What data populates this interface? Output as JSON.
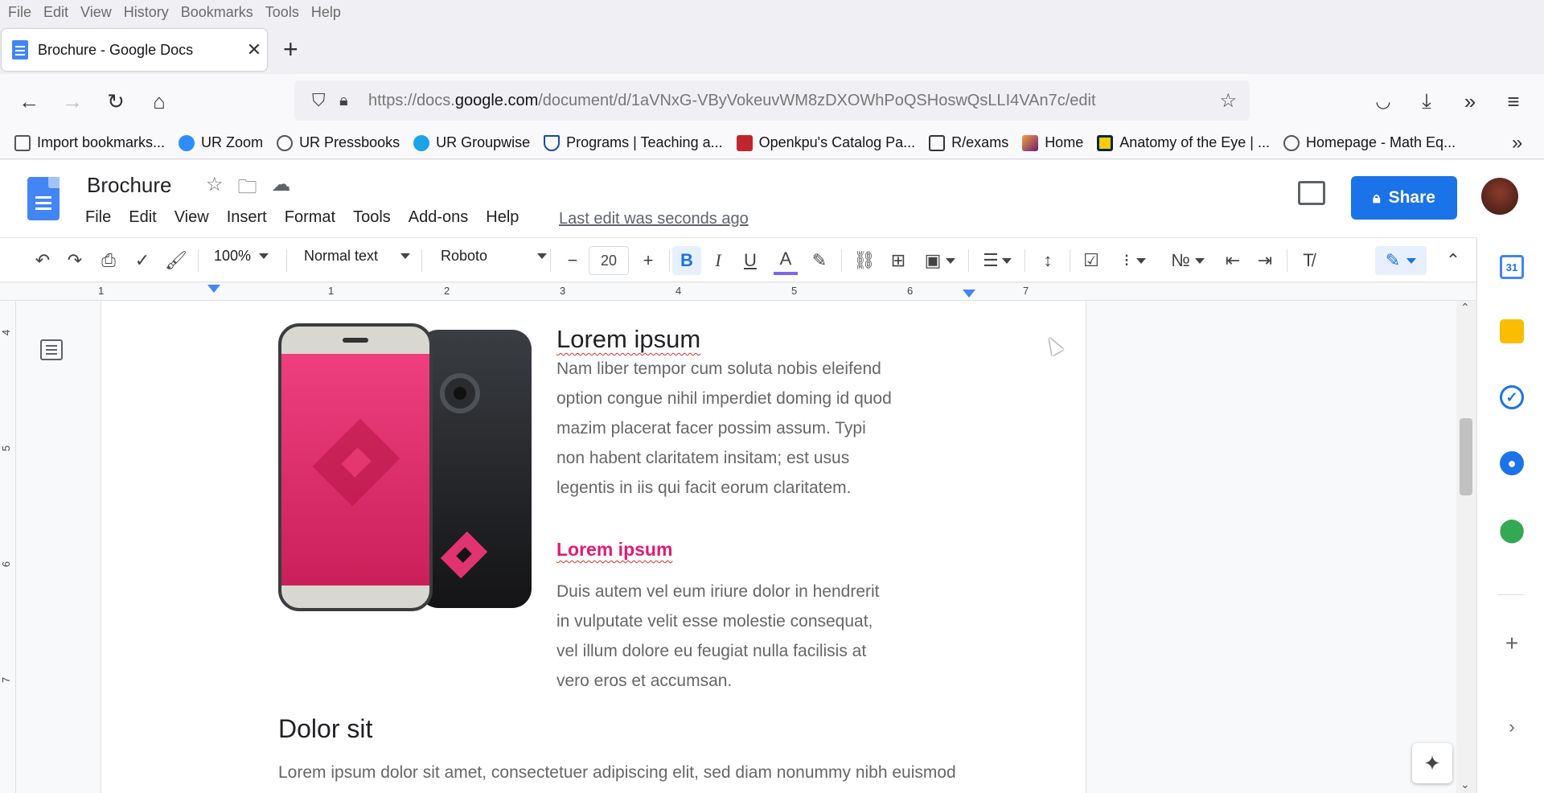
{
  "browser": {
    "menu": [
      "File",
      "Edit",
      "View",
      "History",
      "Bookmarks",
      "Tools",
      "Help"
    ],
    "tab_title": "Brochure - Google Docs",
    "url_prefix": "https://docs.",
    "url_domain": "google.com",
    "url_path": "/document/d/1aVNxG-VByVokeuvWM8zDXOWhPoQSHoswQsLLI4VAn7c/edit",
    "bookmarks": [
      {
        "label": "Import bookmarks...",
        "icon": "import-icon",
        "color": "#555555"
      },
      {
        "label": "UR Zoom",
        "icon": "zoom-icon",
        "color": "#2d8cff"
      },
      {
        "label": "UR Pressbooks",
        "icon": "globe-icon",
        "color": "#555555"
      },
      {
        "label": "UR Groupwise",
        "icon": "groupwise-icon",
        "color": "#1aa3e8"
      },
      {
        "label": "Programs | Teaching a...",
        "icon": "programs-icon",
        "color": "#1a4b9c"
      },
      {
        "label": "Openkpu's Catalog Pa...",
        "icon": "pb-icon",
        "color": "#c0262d"
      },
      {
        "label": "R/exams",
        "icon": "check-icon",
        "color": "#333333"
      },
      {
        "label": "Home",
        "icon": "home-site-icon",
        "color": "#8b3a8f"
      },
      {
        "label": "Anatomy of the Eye | ...",
        "icon": "michigan-icon",
        "color": "#00274c"
      },
      {
        "label": "Homepage - Math Eq...",
        "icon": "globe-icon",
        "color": "#555555"
      }
    ]
  },
  "docs": {
    "title": "Brochure",
    "menus": [
      "File",
      "Edit",
      "View",
      "Insert",
      "Format",
      "Tools",
      "Add-ons",
      "Help"
    ],
    "last_edit": "Last edit was seconds ago",
    "share_label": "Share",
    "toolbar": {
      "zoom": "100%",
      "style": "Normal text",
      "font": "Roboto",
      "font_size": "20"
    },
    "ruler_numbers": [
      "1",
      "1",
      "2",
      "3",
      "4",
      "5",
      "6",
      "7"
    ],
    "vruler_numbers": [
      "4",
      "5",
      "6",
      "7"
    ]
  },
  "document": {
    "heading1": "Lorem ipsum",
    "paragraph1": "Nam liber tempor cum soluta nobis eleifend option congue nihil imperdiet doming id quod mazim placerat facer possim assum. Typi non habent claritatem insitam; est usus legentis in iis qui facit eorum claritatem.",
    "heading2": "Lorem ipsum",
    "paragraph2": "Duis autem vel eum iriure dolor in hendrerit in vulputate velit esse molestie consequat, vel illum dolore eu feugiat nulla facilisis at vero eros et accumsan.",
    "heading3": "Dolor sit",
    "paragraph3": "Lorem ipsum dolor sit amet, consectetuer adipiscing elit, sed diam nonummy nibh euismod"
  },
  "side_panel": {
    "calendar_label": "31"
  },
  "colors": {
    "accent": "#1a73e8",
    "pink": "#e01b74"
  }
}
